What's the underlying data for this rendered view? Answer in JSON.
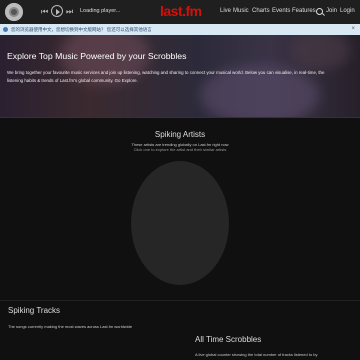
{
  "topbar": {
    "prev_icon": "⏮",
    "next_icon": "⏭",
    "player_status": "Loading player...",
    "brand": "last.fm",
    "nav": [
      "Live",
      "Music",
      "Charts",
      "Events",
      "Features"
    ],
    "join": "Join",
    "login": "Login"
  },
  "notice": {
    "text": "您的浏览器使用中文，您想切换到中文版网站？ 您还可以选择其他语言",
    "close": "×"
  },
  "hero": {
    "title": "Explore Top Music Powered by your Scrobbles",
    "body": "We bring together your favourite music services and join up listening, watching and sharing to connect your musical world. Below you can visualise, in real-time, the listening habits & trends of Last.fm's global community. Go Explore."
  },
  "spiking_artists": {
    "title": "Spiking Artists",
    "subtitle": "These artists are trending globally on Last.fm right now",
    "hint": "Click one to explore the artist and their similar artists"
  },
  "spiking_tracks": {
    "title": "Spiking Tracks",
    "subtitle": "The songs currently making the most waves across Last.fm worldwide"
  },
  "all_time": {
    "title": "All Time Scrobbles",
    "subtitle": "A live global counter showing the total number of tracks listened to by"
  },
  "colors": {
    "brand_red": "#d51007",
    "notice_bg": "#d9e8f5",
    "page_bg": "#101010"
  }
}
